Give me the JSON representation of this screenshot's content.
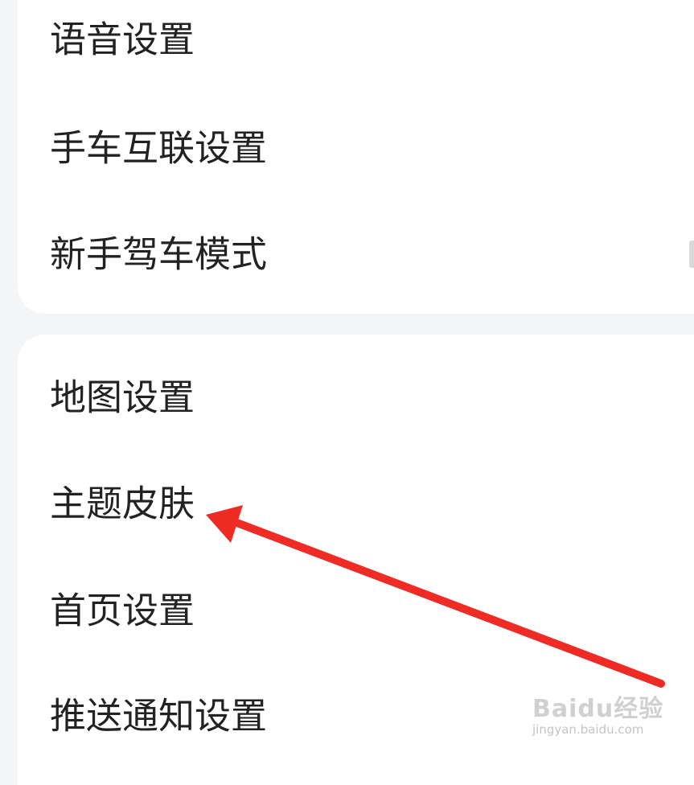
{
  "colors": {
    "page_background": "#f4f5f7",
    "card_background": "#ffffff",
    "text": "#222222",
    "annotation_arrow": "#ee2b24"
  },
  "settings_groups": [
    {
      "items": [
        {
          "label": "语音设置"
        },
        {
          "label": "手车互联设置"
        },
        {
          "label": "新手驾车模式"
        }
      ]
    },
    {
      "items": [
        {
          "label": "地图设置"
        },
        {
          "label": "主题皮肤"
        },
        {
          "label": "首页设置"
        },
        {
          "label": "推送通知设置"
        }
      ]
    }
  ],
  "annotation": {
    "type": "arrow",
    "points_to": "主题皮肤",
    "icon": "red-arrow-icon"
  },
  "watermark": {
    "logo_text": "Baidu经验",
    "url_text": "jingyan.baidu.com"
  }
}
